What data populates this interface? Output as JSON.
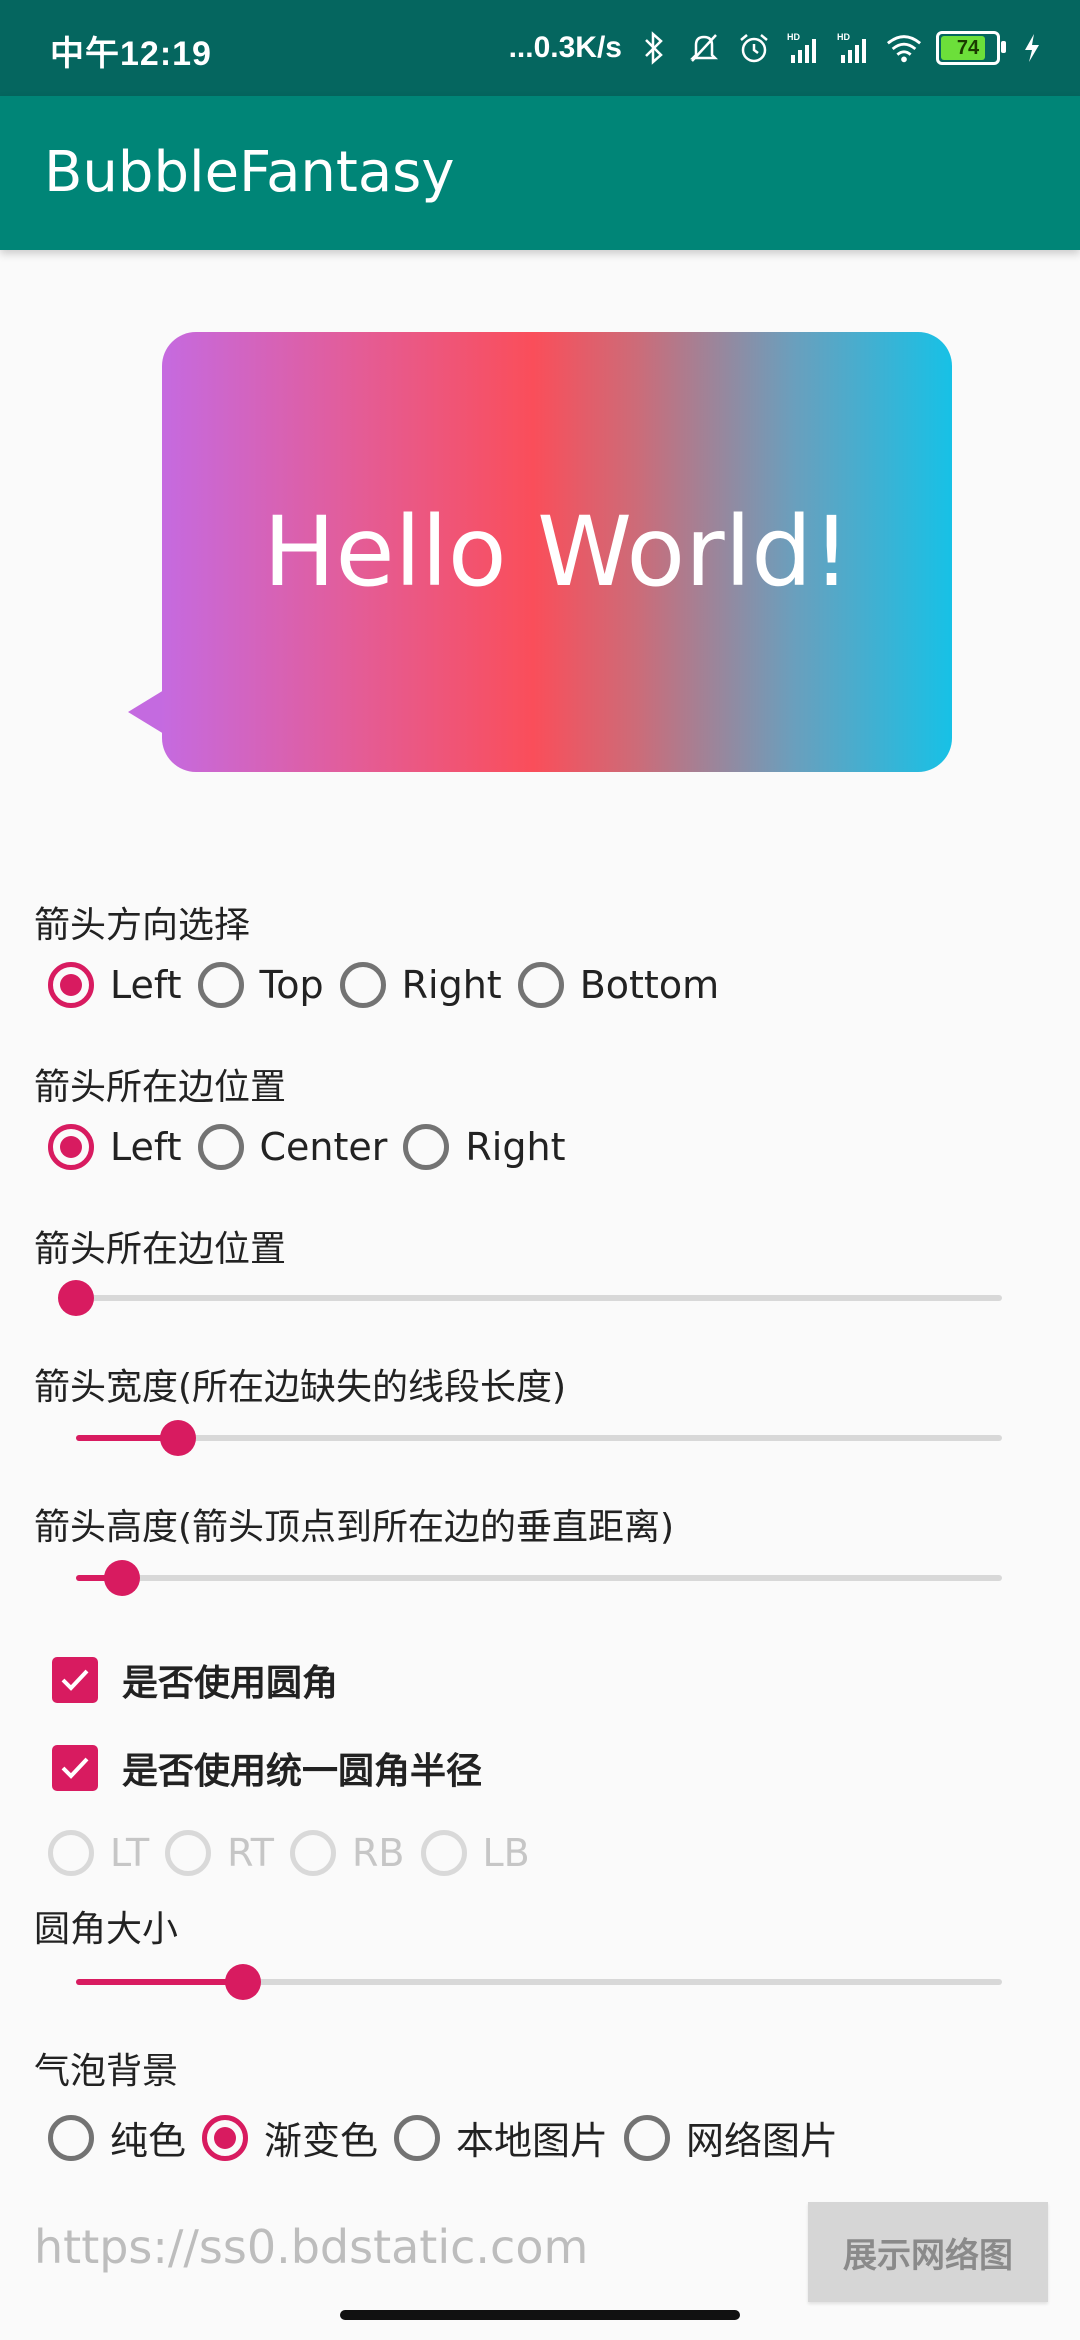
{
  "status": {
    "time": "中午12:19",
    "network_speed": "...0.3K/s",
    "battery": "74",
    "icons": [
      "bluetooth-icon",
      "mute-icon",
      "alarm-icon",
      "signal-hd-icon",
      "signal-hd-icon",
      "wifi-icon",
      "battery-icon",
      "charging-icon"
    ]
  },
  "appbar": {
    "title": "BubbleFantasy"
  },
  "bubble": {
    "text": "Hello World!",
    "gradient": [
      "#c56ae0",
      "#fa4e5a",
      "#17c1e6"
    ]
  },
  "arrow_direction": {
    "label": "箭头方向选择",
    "options": [
      "Left",
      "Top",
      "Right",
      "Bottom"
    ],
    "selected": "Left"
  },
  "arrow_edge_position": {
    "label": "箭头所在边位置",
    "options": [
      "Left",
      "Center",
      "Right"
    ],
    "selected": "Left"
  },
  "slider_edge_position": {
    "label": "箭头所在边位置",
    "value": 0
  },
  "slider_arrow_width": {
    "label": "箭头宽度(所在边缺失的线段长度)",
    "value": 0.11
  },
  "slider_arrow_height": {
    "label": "箭头高度(箭头顶点到所在边的垂直距离)",
    "value": 0.05
  },
  "use_corner": {
    "label": "是否使用圆角",
    "checked": true
  },
  "use_uniform_radius": {
    "label": "是否使用统一圆角半径",
    "checked": true
  },
  "corner_options": {
    "options": [
      "LT",
      "RT",
      "RB",
      "LB"
    ],
    "disabled": true
  },
  "slider_corner_size": {
    "label": "圆角大小",
    "value": 0.18
  },
  "background": {
    "label": "气泡背景",
    "options": [
      "纯色",
      "渐变色",
      "本地图片",
      "网络图片"
    ],
    "selected": "渐变色"
  },
  "url_input": {
    "value": "https://ss0.bdstatic.com"
  },
  "show_button": {
    "label": "展示网络图"
  },
  "colors": {
    "accent": "#d81b60",
    "appbar": "#008577",
    "statusbar": "#05665f"
  }
}
